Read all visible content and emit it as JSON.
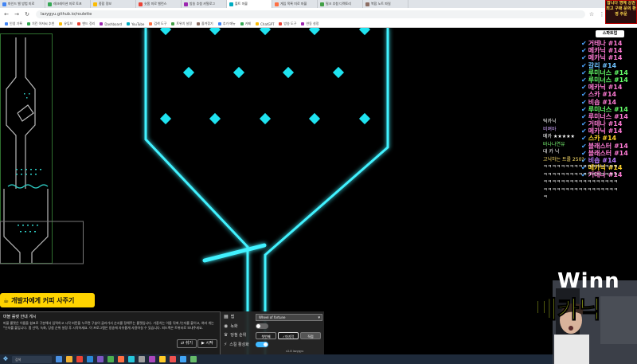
{
  "browser": {
    "tabs": [
      "마인드 밸 방법 미로",
      "레크레이션 미로 토포",
      "종합 정보",
      "숏폼 미로 밸런스",
      "방송 추첨 카탈로그",
      "볼트 마블",
      "게임 목록 미로 마블",
      "밀크 추첨 디렉토리",
      "복합 노트 파일"
    ],
    "url": "lazygyu.github.io/roulette",
    "bookmarks": [
      "인생 기록",
      "치킨 아저씨 추천",
      "유튜브",
      "밴드 정리",
      "Dashboard",
      "YouTube",
      "검색 도구",
      "트위치 설정",
      "즐겨찾기",
      "추가 메뉴",
      "카페",
      "ChatGPT",
      "방송 도구",
      "연동 설정"
    ]
  },
  "donation_banner": {
    "icon": "coffee-cup-icon",
    "label": "개발자에게 커피 사주기"
  },
  "info_panel": {
    "title": "마블 룰렛 안내 게시",
    "body": "마블 룰렛은 이름을 쉼표로 구분해서 입력하고 시작 버튼을 누르면 구슬이 굴러가서 순서를 정해주는 룰렛입니다. 가중치는 이름 뒤에 /숫자를 붙이고, 여러 개는 *숫자를 붙입니다. 맵 선택, 녹화, 당첨 순위 설정 후 시작하세요. 이 프로그램은 방송에 자유롭게 사용하실 수 있습니다. 피드백은 트위터로 보내주세요.",
    "shuffle_button": "섞기",
    "start_button": "시작"
  },
  "settings_panel": {
    "map_label": "맵",
    "map_value": "Wheel of fortune",
    "record_label": "녹화",
    "record_on": false,
    "rank_label": "당첨 순위",
    "rank_first": "첫번째",
    "rank_last": "마지막",
    "rank_custom": "직접",
    "skill_label": "스킬 활성화",
    "skill_on": true,
    "version": "v2.8 lazygyu"
  },
  "taskbar": {
    "search_placeholder": "검색"
  },
  "stream_overlay": {
    "ad_text": "합니다 명예 상권 최고 구매 문의 환영 주문",
    "stream_label": "스파트업",
    "chat_entries": [
      {
        "name": "거테나",
        "count": "#14",
        "color": "#ff7bd5"
      },
      {
        "name": "메카닉",
        "count": "#14",
        "color": "#ff7bd5"
      },
      {
        "name": "메카닉",
        "count": "#14",
        "color": "#ff7bd5"
      },
      {
        "name": "갈리",
        "count": "#14",
        "color": "#6ec2ff"
      },
      {
        "name": "루미너스",
        "count": "#14",
        "color": "#64ff6a"
      },
      {
        "name": "루미너스",
        "count": "#14",
        "color": "#64ff6a"
      },
      {
        "name": "메카닉",
        "count": "#14",
        "color": "#ff7bd5"
      },
      {
        "name": "스카",
        "count": "#14",
        "color": "#ff7bd5"
      },
      {
        "name": "비숍",
        "count": "#14",
        "color": "#ff7bd5"
      },
      {
        "name": "루미너스",
        "count": "#14",
        "color": "#64ff6a"
      },
      {
        "name": "루미너스",
        "count": "#14",
        "color": "#ff7bd5"
      },
      {
        "name": "거테나",
        "count": "#14",
        "color": "#ff7bd5"
      },
      {
        "name": "메카닉",
        "count": "#14",
        "color": "#ff7bd5"
      },
      {
        "name": "스카",
        "count": "#14",
        "color": "#ffd42a"
      },
      {
        "name": "블래스터",
        "count": "#14",
        "color": "#ff7bd5"
      },
      {
        "name": "블래스터",
        "count": "#14",
        "color": "#ff7bd5"
      },
      {
        "name": "비숍",
        "count": "#14",
        "color": "#bb7bff"
      },
      {
        "name": "메카닉",
        "count": "#14",
        "color": "#ffd42a"
      },
      {
        "name": "거테나",
        "count": "#14",
        "color": "#ff7bd5"
      }
    ],
    "chat_lines": [
      {
        "text": "틱카닉",
        "color": "#ffffff"
      },
      {
        "text": "비벼바",
        "color": "#d1a6ff"
      },
      {
        "text": "메카 ★★★★★",
        "color": "#ffffff"
      },
      {
        "text": "바나나연유",
        "color": "#7dff76"
      },
      {
        "text": "대 카 닉",
        "color": "#ffffff"
      },
      {
        "text": "고닉하는 트롤 250?",
        "color": "#ffe16b"
      },
      {
        "text": "ㅋㅋㅋㅋㅋㅋㅋㅋㅋㅋㅋㅋㅋㅋㅋㅋㅋ",
        "color": "#ffffff"
      },
      {
        "text": "ㅋㅋㅋㅋㅋㅋㅋㅋㅋㅋㅋㅋㅋㅋㅋㅋㅋ",
        "color": "#ffffff"
      },
      {
        "text": "ㅋㅋㅋㅋㅋㅋㅋㅋㅋㅋㅋㅋㅋㅋㅋㅋㅋ",
        "color": "#ffffff"
      },
      {
        "text": "ㅋㅋㅋㅋㅋㅋㅋㅋㅋㅋㅋㅋㅋㅋㅋㅋㅋ",
        "color": "#ffffff"
      },
      {
        "text": "ㅋ",
        "color": "#ffffff"
      }
    ],
    "winner_text": "Winn",
    "winner_name": "메카닉"
  },
  "colors": {
    "wall": "#41f2ff",
    "peg": "#1fe3f0",
    "minimap_wall": "#bbbbbb",
    "accent_toggle": "#3fb8ff"
  }
}
